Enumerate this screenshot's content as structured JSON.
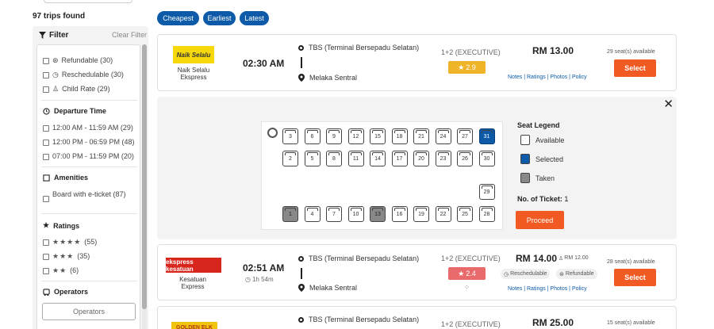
{
  "results": {
    "count_text": "97 trips found"
  },
  "filter": {
    "title": "Filter",
    "clear_label": "Clear Filter",
    "general": [
      {
        "label": "Refundable (30)",
        "icon": "refund-icon"
      },
      {
        "label": "Reschedulable (30)",
        "icon": "reschedule-icon"
      },
      {
        "label": "Child Rate (29)",
        "icon": "child-icon"
      }
    ],
    "departure": {
      "title": "Departure Time",
      "items": [
        "12:00 AM - 11:59 AM (29)",
        "12:00 PM - 06:59 PM (48)",
        "07:00 PM - 11:59 PM (20)"
      ]
    },
    "amenities": {
      "title": "Amenities",
      "items": [
        "Board with e-ticket (87)"
      ]
    },
    "ratings": {
      "title": "Ratings",
      "items": [
        {
          "stars": "★★★★",
          "count": "(55)"
        },
        {
          "stars": "★★★",
          "count": "(35)"
        },
        {
          "stars": "★★",
          "count": "(6)"
        }
      ]
    },
    "operators": {
      "title": "Operators",
      "button_label": "Operators"
    }
  },
  "sort": {
    "cheapest": "Cheapest",
    "earliest": "Earliest",
    "latest": "Latest",
    "active_color": "#0c5aa8"
  },
  "trips": [
    {
      "operator_logo_text": "Naik Selalu",
      "operator_name": "Naik Selalu Ekspress",
      "departure_time": "02:30 AM",
      "from": "TBS (Terminal Bersepadu Selatan)",
      "to": "Melaka Sentral",
      "bus_class": "1+2 (EXECUTIVE)",
      "rating": "2.9",
      "rating_color": "#f0b429",
      "price": "RM 13.00",
      "links": "Notes | Ratings | Photos | Policy",
      "seats_available": "29 seat(s) available",
      "select_label": "Select"
    },
    {
      "operator_logo_text": "ekspress kesatuan",
      "operator_name": "Kesatuan Express",
      "departure_time": "02:51 AM",
      "duration": "1h 54m",
      "from": "TBS (Terminal Bersepadu Selatan)",
      "to": "Melaka Sentral",
      "bus_class": "1+2 (EXECUTIVE)",
      "rating": "2.4",
      "rating_color": "#e86a6a",
      "price": "RM 14.00",
      "child_price": "RM 12.00",
      "tags": [
        "Reschedulable",
        "Refundable"
      ],
      "links": "Notes | Ratings | Photos | Policy",
      "seats_available": "28 seat(s) available",
      "select_label": "Select"
    },
    {
      "operator_logo_text": "GOLDEN ELK",
      "from": "TBS (Terminal Bersepadu Selatan)",
      "bus_class": "1+2 (EXECUTIVE)",
      "price": "RM 25.00",
      "seats_available": "15 seat(s) available"
    }
  ],
  "seat_map": {
    "legend_title": "Seat Legend",
    "legend": {
      "available": "Available",
      "selected": "Selected",
      "taken": "Taken"
    },
    "ticket_label": "No. of Ticket:",
    "ticket_count": "1",
    "proceed_label": "Proceed",
    "close_label": "✕",
    "row_top": [
      {
        "n": "3",
        "state": "available"
      },
      {
        "n": "6",
        "state": "available"
      },
      {
        "n": "9",
        "state": "available"
      },
      {
        "n": "12",
        "state": "available"
      },
      {
        "n": "15",
        "state": "available"
      },
      {
        "n": "18",
        "state": "available"
      },
      {
        "n": "21",
        "state": "available"
      },
      {
        "n": "24",
        "state": "available"
      },
      {
        "n": "27",
        "state": "available"
      },
      {
        "n": "31",
        "state": "selected"
      }
    ],
    "row_mid": [
      {
        "n": "2",
        "state": "available"
      },
      {
        "n": "5",
        "state": "available"
      },
      {
        "n": "8",
        "state": "available"
      },
      {
        "n": "11",
        "state": "available"
      },
      {
        "n": "14",
        "state": "available"
      },
      {
        "n": "17",
        "state": "available"
      },
      {
        "n": "20",
        "state": "available"
      },
      {
        "n": "23",
        "state": "available"
      },
      {
        "n": "26",
        "state": "available"
      },
      {
        "n": "30",
        "state": "available"
      }
    ],
    "aisle_seat": {
      "n": "29",
      "state": "available"
    },
    "row_bottom": [
      {
        "n": "1",
        "state": "taken"
      },
      {
        "n": "4",
        "state": "available"
      },
      {
        "n": "7",
        "state": "available"
      },
      {
        "n": "10",
        "state": "available"
      },
      {
        "n": "13",
        "state": "taken"
      },
      {
        "n": "16",
        "state": "available"
      },
      {
        "n": "19",
        "state": "available"
      },
      {
        "n": "22",
        "state": "available"
      },
      {
        "n": "25",
        "state": "available"
      },
      {
        "n": "28",
        "state": "available"
      }
    ]
  }
}
